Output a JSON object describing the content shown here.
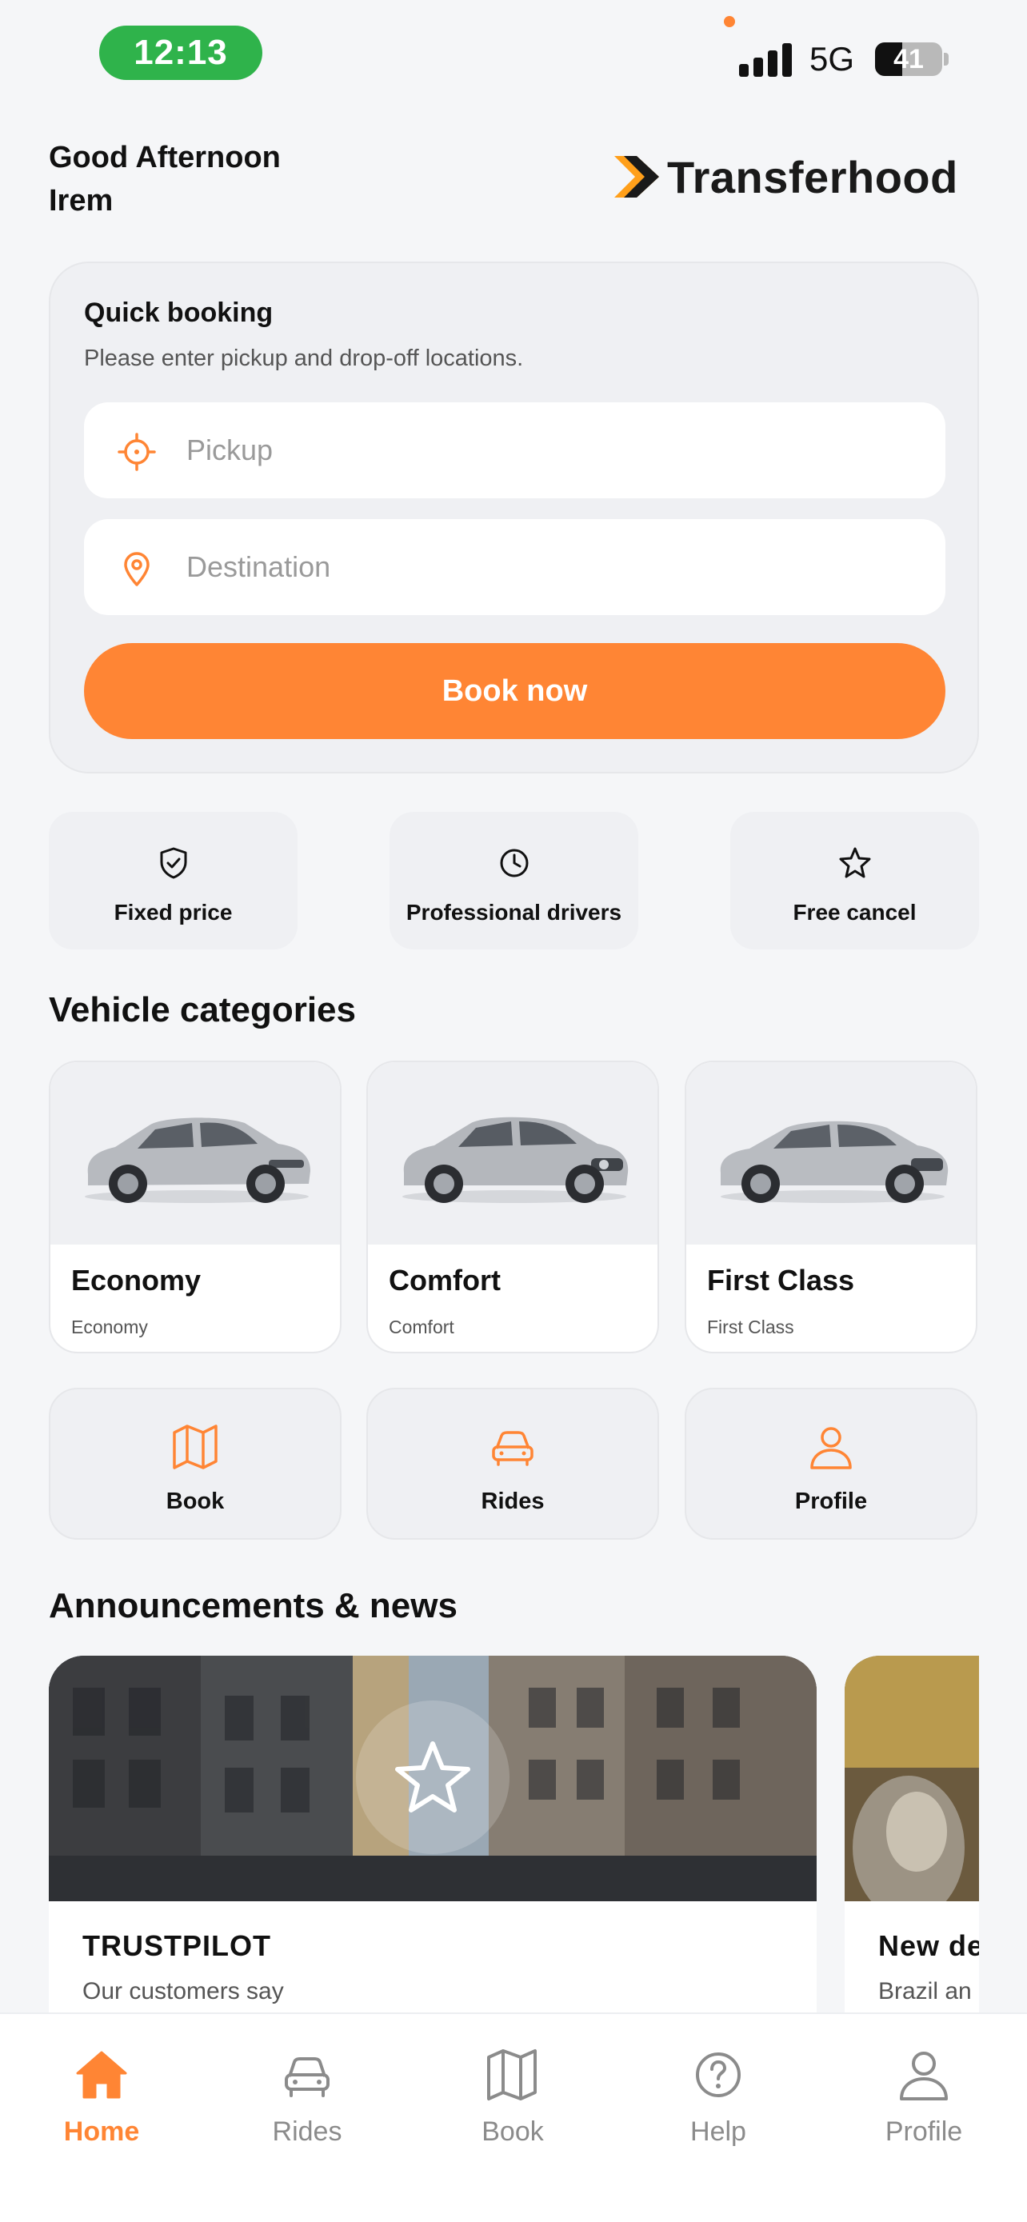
{
  "status_bar": {
    "time": "12:13",
    "network": "5G",
    "battery": "41",
    "battery_level": 0.41
  },
  "header": {
    "greeting_line1": "Good Afternoon",
    "greeting_line2": "Irem",
    "logo_text": "Transferhood"
  },
  "quick_booking": {
    "title": "Quick booking",
    "subtitle": "Please enter pickup and drop-off locations.",
    "pickup_placeholder": "Pickup",
    "destination_placeholder": "Destination",
    "pickup_value": "",
    "destination_value": "",
    "book_label": "Book now"
  },
  "features": [
    {
      "label": "Fixed price",
      "icon": "shield-check-icon"
    },
    {
      "label": "Professional drivers",
      "icon": "clock-icon"
    },
    {
      "label": "Free cancel",
      "icon": "star-icon"
    }
  ],
  "vehicle_section_title": "Vehicle categories",
  "vehicles": [
    {
      "name": "Economy",
      "sub": "Economy",
      "icon": "car-image"
    },
    {
      "name": "Comfort",
      "sub": "Comfort",
      "icon": "car-image"
    },
    {
      "name": "First Class",
      "sub": "First Class",
      "icon": "car-image"
    }
  ],
  "shortcuts": [
    {
      "label": "Book",
      "icon": "map-icon"
    },
    {
      "label": "Rides",
      "icon": "car-icon"
    },
    {
      "label": "Profile",
      "icon": "user-icon"
    }
  ],
  "news_section_title": "Announcements & news",
  "news": [
    {
      "title": "TRUSTPILOT",
      "sub": "Our customers say"
    },
    {
      "title": "New de",
      "sub": "Brazil an"
    }
  ],
  "bottom_nav": [
    {
      "label": "Home",
      "icon": "home-icon",
      "active": true
    },
    {
      "label": "Rides",
      "icon": "car-icon",
      "active": false
    },
    {
      "label": "Book",
      "icon": "map-icon",
      "active": false
    },
    {
      "label": "Help",
      "icon": "help-icon",
      "active": false
    },
    {
      "label": "Profile",
      "icon": "user-icon",
      "active": false
    }
  ],
  "colors": {
    "accent": "#ff8534",
    "background": "#f5f6f8",
    "card": "#eff0f3",
    "time_pill": "#2fb34b"
  }
}
